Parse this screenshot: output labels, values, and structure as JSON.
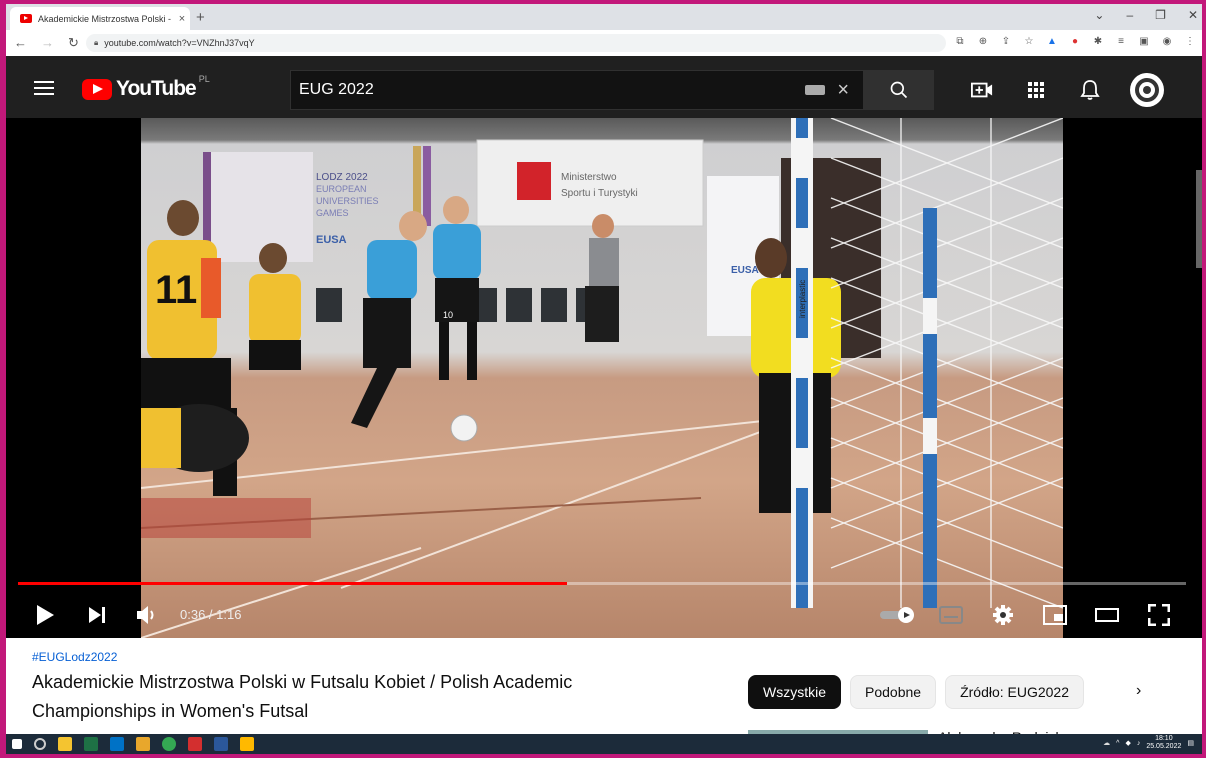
{
  "browser": {
    "tab_title": "Akademickie Mistrzostwa Polski -",
    "tab_close": "×",
    "new_tab": "+",
    "url": "youtube.com/watch?v=VNZhnJ37vqY",
    "window_controls": [
      "⌄",
      "–",
      "❐",
      "✕"
    ]
  },
  "youtube": {
    "logo_text": "YouTube",
    "country_code": "PL",
    "search_value": "EUG 2022",
    "search_clear": "×"
  },
  "scene": {
    "banner_lodz": [
      "LODZ 2022",
      "EUROPEAN",
      "UNIVERSITIES",
      "GAMES"
    ],
    "banner_eusa": "EUSA",
    "banner_ministry": [
      "Ministerstwo",
      "Sportu i Turystyki"
    ],
    "banner_right": "EUSA",
    "jersey_left_number": "11",
    "jersey_mid_number": "10",
    "post_text": "interplastic"
  },
  "player": {
    "time_current": "0:36",
    "time_separator": " / ",
    "time_total": "1:16",
    "progress": 0.47
  },
  "below": {
    "hashtag": "#EUGLodz2022",
    "title": "Akademickie Mistrzostwa Polski w Futsalu Kobiet / Polish Academic Championships in Women's Futsal",
    "chips": [
      {
        "label": "Wszystkie",
        "active": true
      },
      {
        "label": "Podobne",
        "active": false
      },
      {
        "label": "Źródło: EUG2022",
        "active": false
      }
    ],
    "next_chevron": "›",
    "peek_title": "Aleksandra Rudnicka"
  },
  "taskbar": {
    "time": "18:10",
    "date": "25.05.2022"
  },
  "colors": {
    "yt_red": "#ff0000",
    "progress_red": "#ff0000",
    "link_blue": "#065fd4",
    "desktop_bg": "#c2187a"
  }
}
